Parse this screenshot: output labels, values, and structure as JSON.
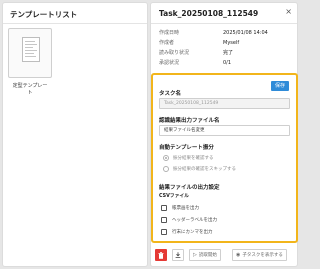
{
  "left_panel": {
    "title": "テンプレートリスト",
    "cards": [
      {
        "label": "定型テンプレー\nト"
      }
    ]
  },
  "task_panel": {
    "title": "Task_20250108_112549",
    "close_icon": "×",
    "meta": [
      {
        "key": "作成日時",
        "value": "2025/01/08 14:04"
      },
      {
        "key": "作成者",
        "value": "Myself"
      },
      {
        "key": "読み取り状況",
        "value": "完了"
      },
      {
        "key": "承認状況",
        "value": "0/1"
      }
    ]
  },
  "edit_section": {
    "highlight_color": "#f2b51b",
    "save_label": "保存",
    "task_name_label": "タスク名",
    "task_name_value": "Task_20250108_112549",
    "output_name_label": "認識結果出力ファイル名",
    "output_name_value": "結果ファイル名変更",
    "auto_sort_label": "自動テンプレート振分",
    "auto_sort_options": [
      {
        "label": "振分結果を確認する",
        "selected": true
      },
      {
        "label": "振分結果の確認をスキップする",
        "selected": false
      }
    ],
    "output_settings_label": "結果ファイルの出力設定",
    "csv_label": "CSVファイル",
    "csv_options": [
      {
        "label": "帳票画を出力",
        "checked": false
      },
      {
        "label": "ヘッダーラベルを出力",
        "checked": false
      },
      {
        "label": "行末にカンマを出力",
        "checked": false
      }
    ]
  },
  "actions": {
    "delete_color": "#e53935",
    "delete_icon": "trash-icon",
    "download_icon": "download-icon",
    "read_start_label": "読取開始",
    "show_subtask_label": "子タスクを表示する"
  }
}
